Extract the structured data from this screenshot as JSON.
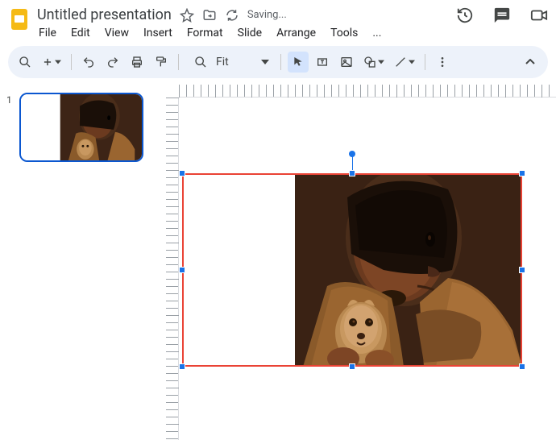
{
  "header": {
    "doc_title": "Untitled presentation",
    "saving_label": "Saving..."
  },
  "menu": {
    "file": "File",
    "edit": "Edit",
    "view": "View",
    "insert": "Insert",
    "format": "Format",
    "slide": "Slide",
    "arrange": "Arrange",
    "tools": "Tools",
    "more": "..."
  },
  "toolbar": {
    "zoom_label": "Fit"
  },
  "filmstrip": {
    "slides": [
      {
        "number": "1"
      }
    ]
  },
  "canvas": {
    "selected_object": "image",
    "selection_color": "#ea4335",
    "handle_color": "#1a73e8"
  }
}
